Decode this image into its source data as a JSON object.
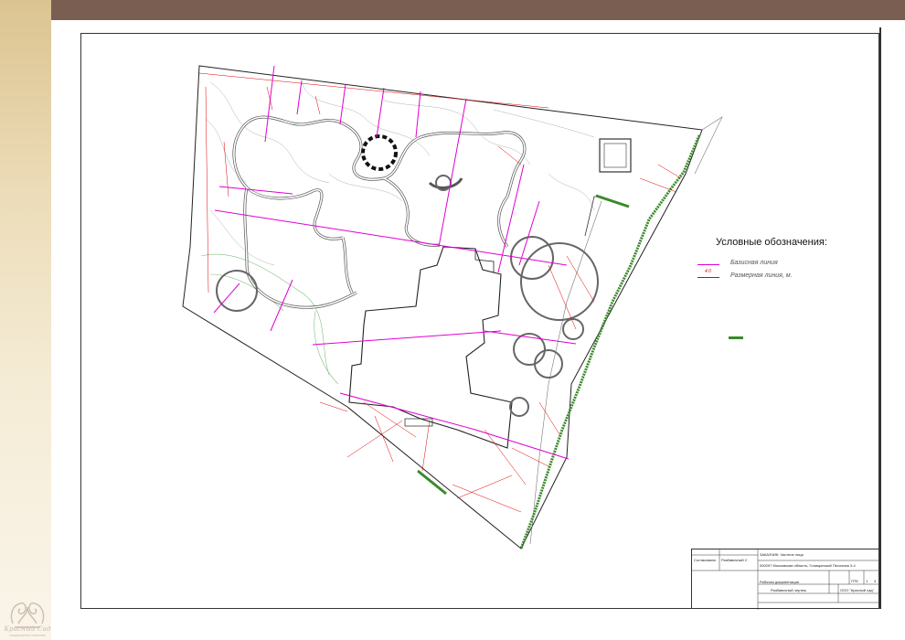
{
  "legend": {
    "title": "Условные обозначения:",
    "items": [
      {
        "label": "Базисная линия",
        "color": "#e000d0"
      },
      {
        "label": "Размерная линия, м.",
        "color": "#e00000",
        "marker": "4.0"
      }
    ]
  },
  "stamp": {
    "customer": "ЗАКАЗЧИК: Частное лицо",
    "address": "000297 Московская область, Голицынский Песочная 3-4",
    "stage": "Рабочая документация",
    "sheet_title": "Разбивочный чертеж",
    "company": "ООО \"Красный сад\"",
    "sheet_code": "ПТК",
    "sheet_num": "1",
    "sheets_total": "4",
    "approved_label": "Согласовано",
    "approved_value": "Разбивочный С"
  },
  "logo": {
    "name": "Красный Сад",
    "tagline": "ландшафтная компания"
  },
  "colors": {
    "base_line": "#e000d0",
    "dim_line": "#e00000",
    "hedge": "#3a8a2a",
    "contour": "#9a9a9a",
    "header_band": "#7a5e52"
  }
}
